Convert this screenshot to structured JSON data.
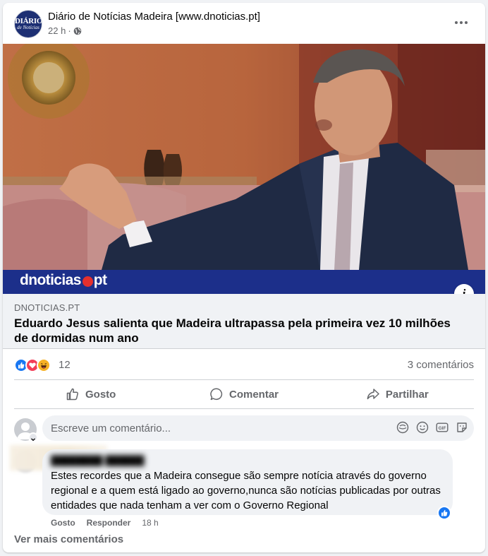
{
  "post": {
    "page_name": "Diário de Notícias Madeira [www.dnoticias.pt]",
    "time": "22 h",
    "privacy_icon": "globe-icon",
    "avatar_logo": {
      "line1": "DIÁRIO",
      "line2": "de Notícias"
    }
  },
  "image": {
    "brand_left": "dnoticias",
    "brand_right": "pt",
    "info_label": "i"
  },
  "link": {
    "domain": "DNOTICIAS.PT",
    "title": "Eduardo Jesus salienta que Madeira ultrapassa pela primeira vez 10 milhões de dormidas num ano"
  },
  "reactions": {
    "icons": [
      "like",
      "love",
      "haha"
    ],
    "count": "12",
    "comments": "3 comentários"
  },
  "actions": {
    "like": "Gosto",
    "comment": "Comentar",
    "share": "Partilhar"
  },
  "write_comment": {
    "placeholder": "Escreve um comentário..."
  },
  "comment": {
    "text": "Estes recordes que a Madeira consegue são sempre notícia através do governo regional e a quem está ligado ao governo,nunca são notícias publicadas por outras entidades que nada tenham a ver com o Governo Regional",
    "like_label": "Gosto",
    "reply_label": "Responder",
    "time": "18 h"
  },
  "more_comments": "Ver mais comentários",
  "colors": {
    "accent": "#1877f2",
    "brand_bar": "#1c2f8a",
    "brand_dot": "#e5302e"
  }
}
